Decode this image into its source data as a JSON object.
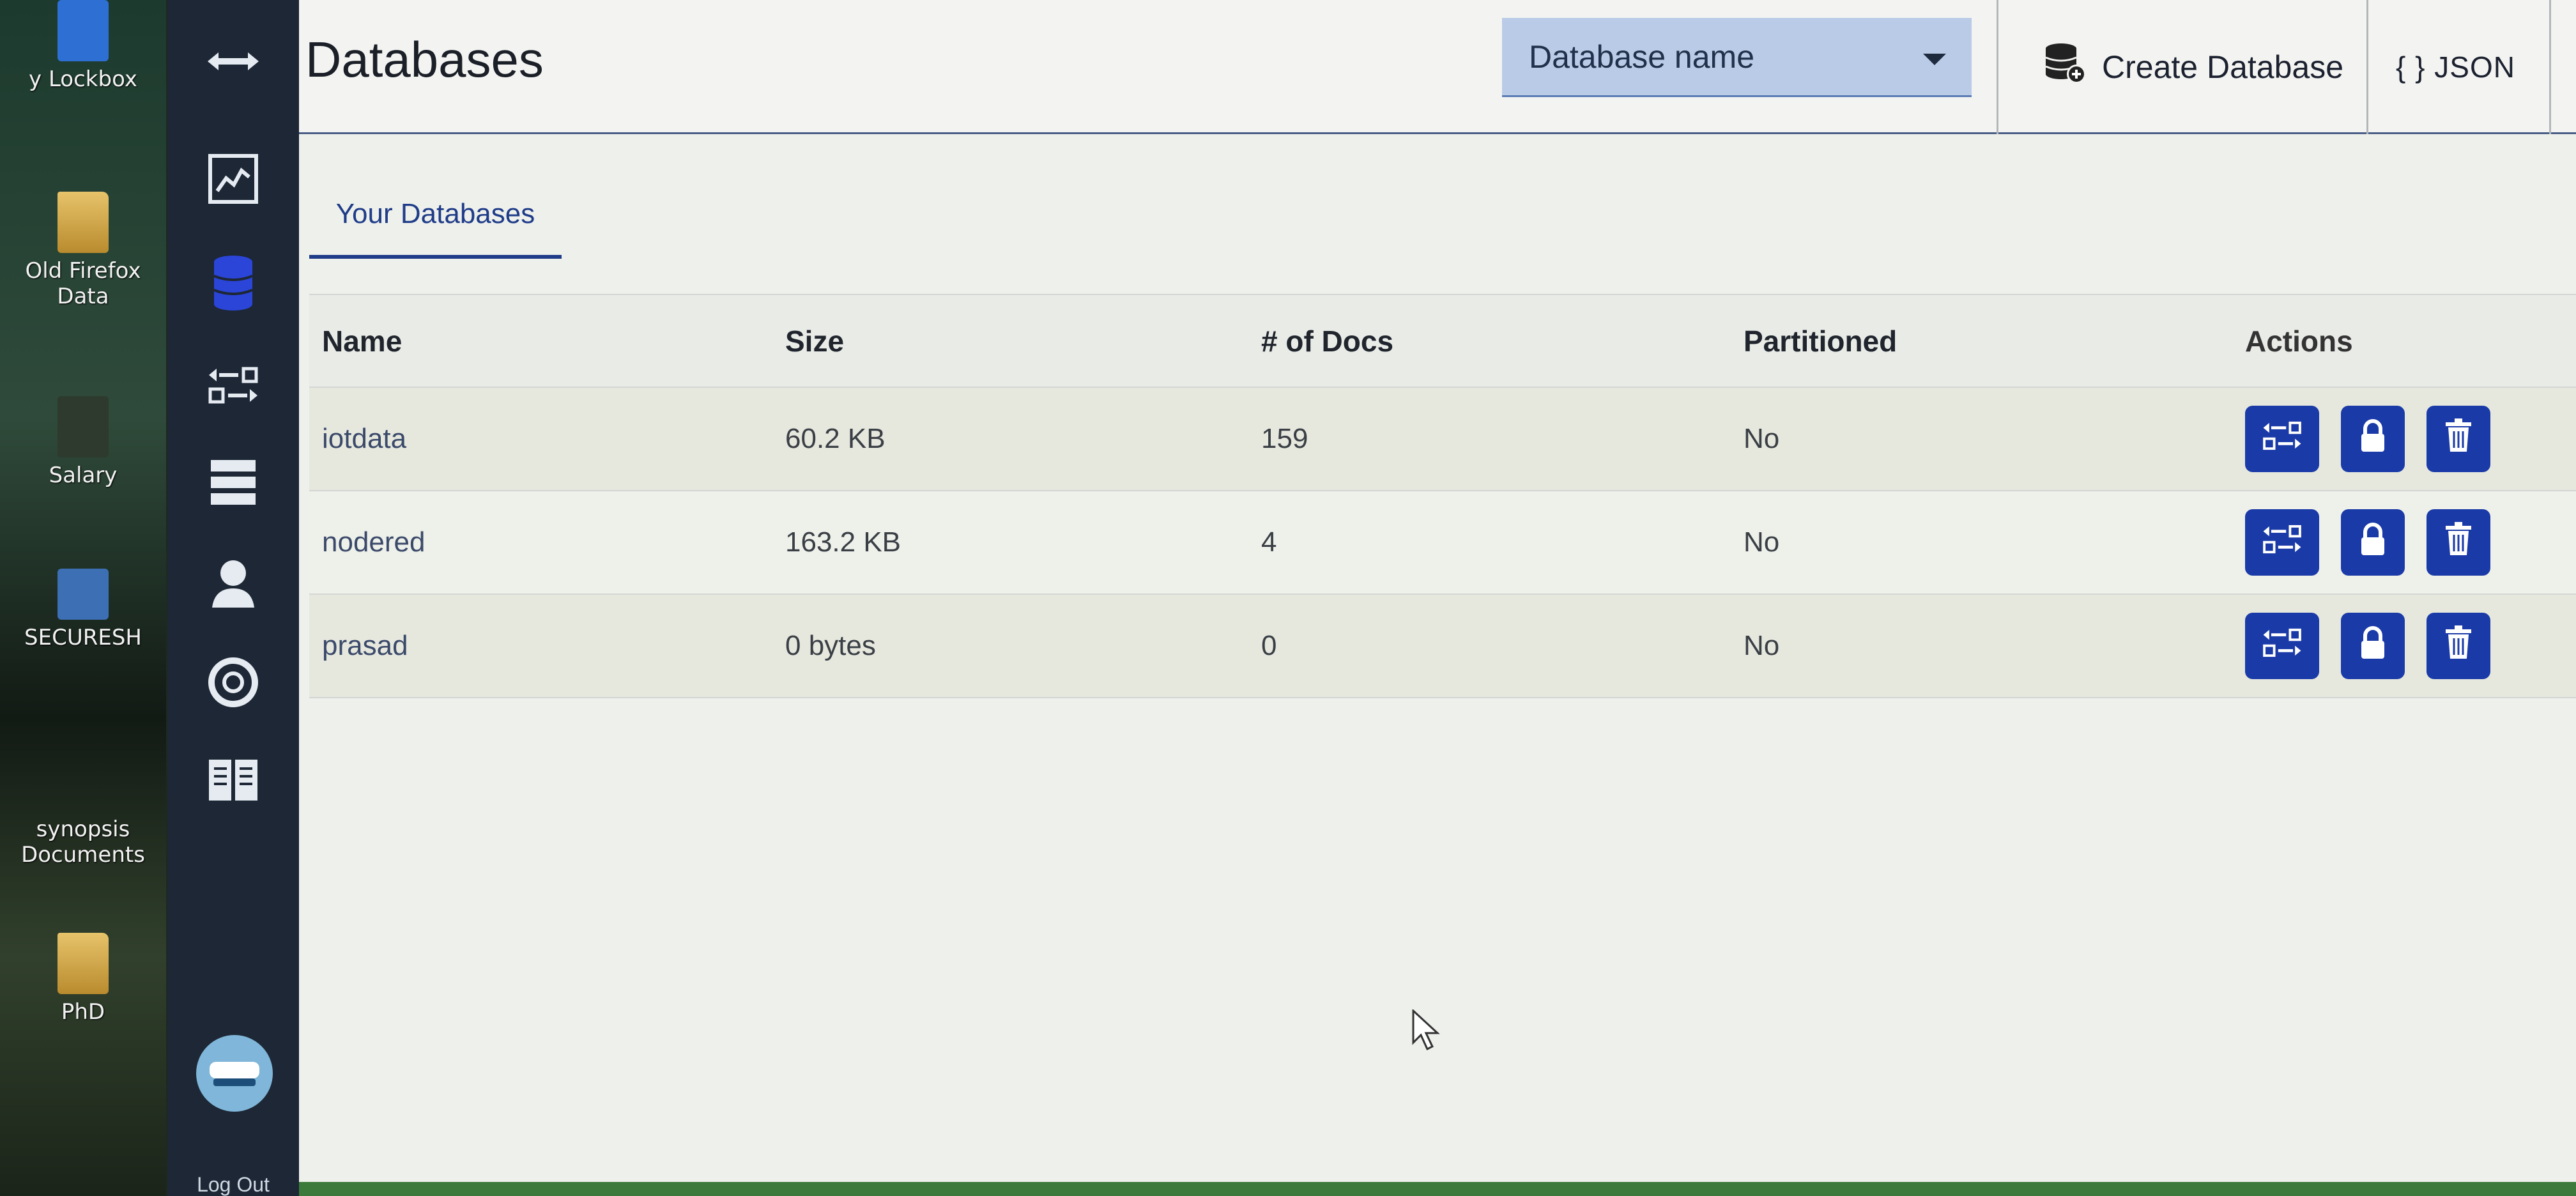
{
  "desktop": {
    "icons": [
      {
        "label": "y Lockbox"
      },
      {
        "label": "Old Firefox Data"
      },
      {
        "label": "Salary"
      },
      {
        "label": "SECURESH"
      },
      {
        "label": "synopsis Documents"
      },
      {
        "label": "PhD"
      }
    ]
  },
  "nav": {
    "items": [
      {
        "icon": "expand-collapse-icon"
      },
      {
        "icon": "activity-chart-icon"
      },
      {
        "icon": "database-icon"
      },
      {
        "icon": "replication-icon"
      },
      {
        "icon": "server-icon"
      },
      {
        "icon": "user-icon"
      },
      {
        "icon": "support-lifebuoy-icon"
      },
      {
        "icon": "documentation-book-icon"
      }
    ],
    "logout_label": "Log Out"
  },
  "header": {
    "title": "Databases",
    "select_value": "Database name",
    "create_label": "Create Database",
    "json_label": "{ } JSON"
  },
  "tabs": [
    {
      "label": "Your Databases",
      "active": true
    }
  ],
  "table": {
    "columns": [
      "Name",
      "Size",
      "# of Docs",
      "Partitioned",
      "Actions"
    ],
    "rows": [
      {
        "name": "iotdata",
        "size": "60.2 KB",
        "docs": "159",
        "partitioned": "No"
      },
      {
        "name": "nodered",
        "size": "163.2 KB",
        "docs": "4",
        "partitioned": "No"
      },
      {
        "name": "prasad",
        "size": "0 bytes",
        "docs": "0",
        "partitioned": "No"
      }
    ]
  },
  "colors": {
    "nav_bg": "#1d2735",
    "accent": "#1f3c88",
    "action_button": "#1a3aa8",
    "select_bg": "#b9cbe6"
  }
}
